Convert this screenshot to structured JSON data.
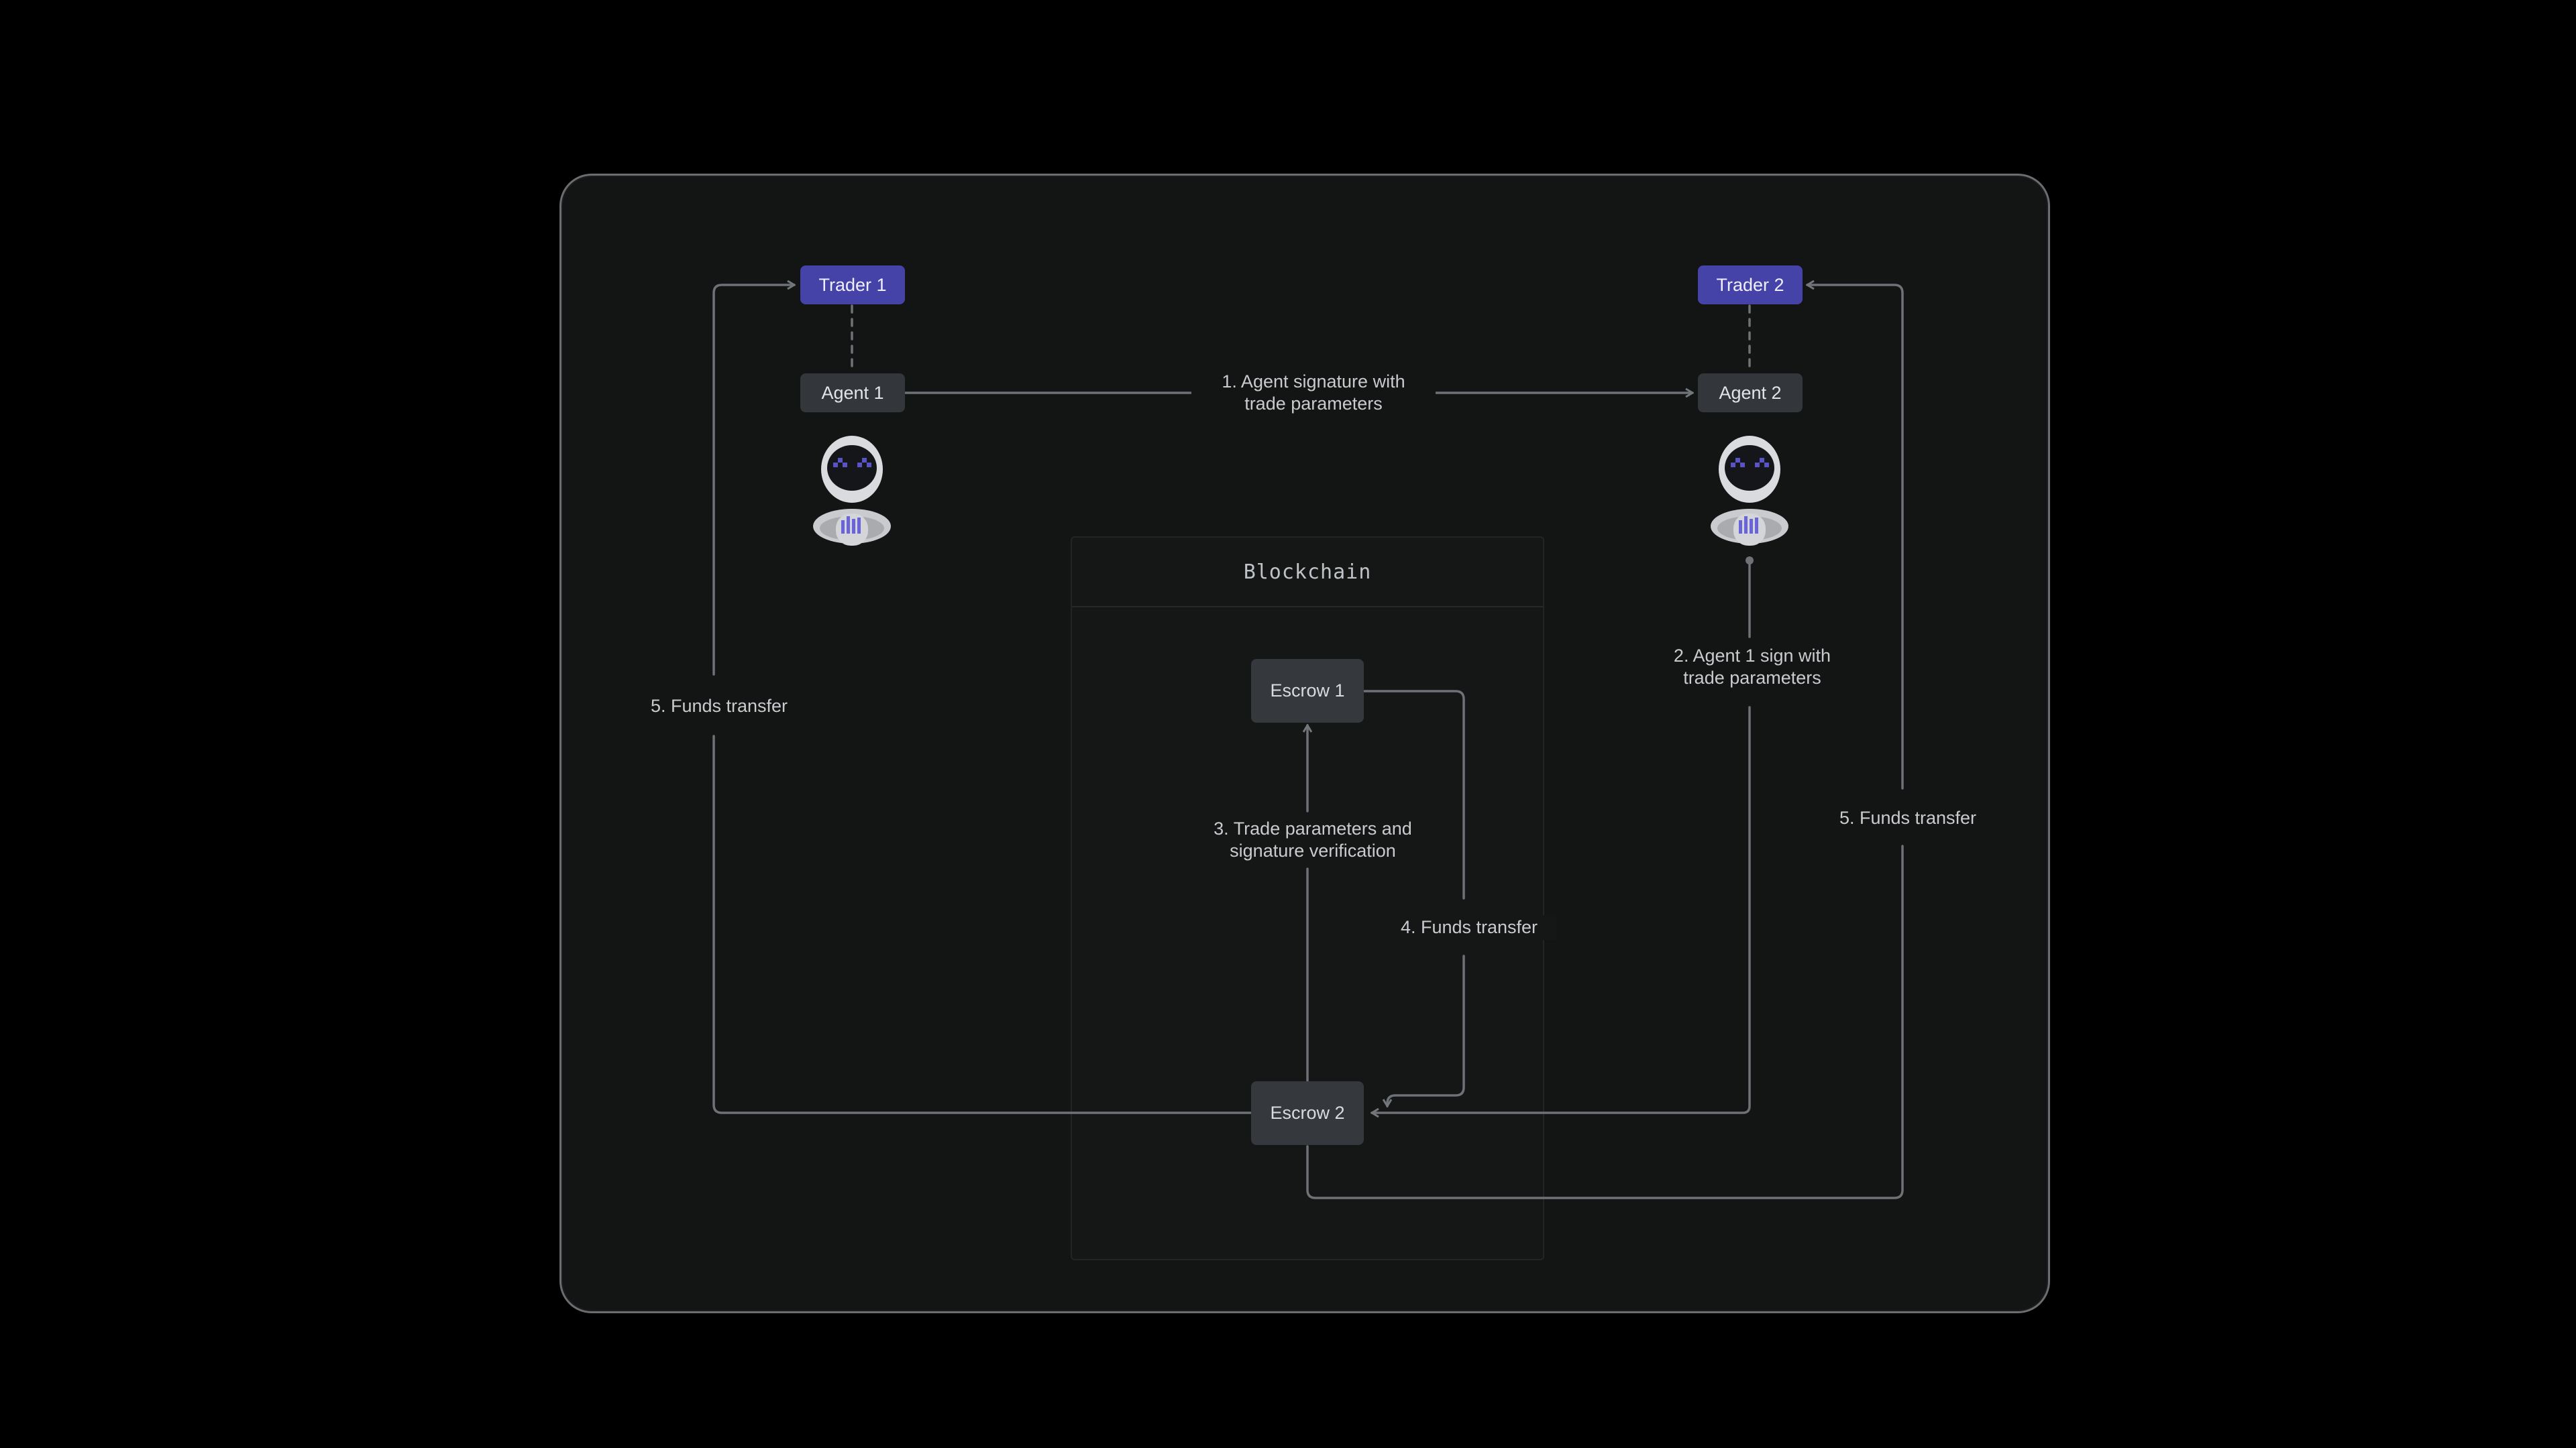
{
  "diagram": {
    "blockchain_title": "Blockchain",
    "nodes": {
      "trader1": "Trader 1",
      "trader2": "Trader 2",
      "agent1": "Agent 1",
      "agent2": "Agent 2",
      "escrow1": "Escrow 1",
      "escrow2": "Escrow 2"
    },
    "edges": {
      "step1": "1. Agent signature with\ntrade parameters",
      "step2": "2. Agent 1 sign with\ntrade parameters",
      "step3": "3. Trade parameters and\nsignature verification",
      "step4": "4. Funds transfer",
      "step5_left": "5. Funds transfer",
      "step5_right": "5. Funds transfer"
    },
    "icons": {
      "agent1_icon": "robot-icon",
      "agent2_icon": "robot-icon"
    },
    "colors": {
      "trader": "#4643a8",
      "node": "#33363b",
      "line": "#6e7176",
      "robot_accent": "#6b63d8"
    }
  }
}
